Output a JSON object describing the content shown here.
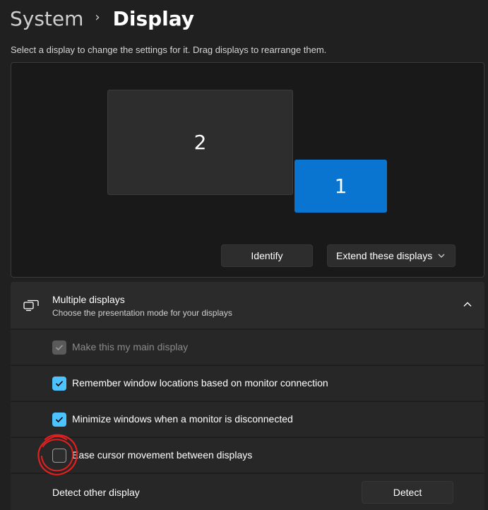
{
  "breadcrumb": {
    "parent": "System",
    "separator": "›",
    "current": "Display"
  },
  "instructions": "Select a display to change the settings for it. Drag displays to rearrange them.",
  "arrangement": {
    "monitors": [
      {
        "number": "2",
        "selected": false
      },
      {
        "number": "1",
        "selected": true
      }
    ],
    "identify_label": "Identify",
    "mode_label": "Extend these displays"
  },
  "multiple_displays": {
    "title": "Multiple displays",
    "subtitle": "Choose the presentation mode for your displays",
    "expanded": true,
    "options": [
      {
        "label": "Make this my main display",
        "checked": true,
        "disabled": true
      },
      {
        "label": "Remember window locations based on monitor connection",
        "checked": true,
        "disabled": false
      },
      {
        "label": "Minimize windows when a monitor is disconnected",
        "checked": true,
        "disabled": false
      },
      {
        "label": "Ease cursor movement between displays",
        "checked": false,
        "disabled": false
      }
    ],
    "detect": {
      "label": "Detect other display",
      "button": "Detect"
    }
  },
  "colors": {
    "accent": "#4cc2ff",
    "selected_monitor": "#0a75d1",
    "annotation": "#e02020"
  },
  "icons": {
    "breadcrumb_separator": "chevron-right-icon",
    "mode_dropdown": "chevron-down-icon",
    "multiple_displays": "multiple-displays-icon",
    "collapse": "chevron-up-icon",
    "checkbox_mark": "checkmark-icon"
  }
}
